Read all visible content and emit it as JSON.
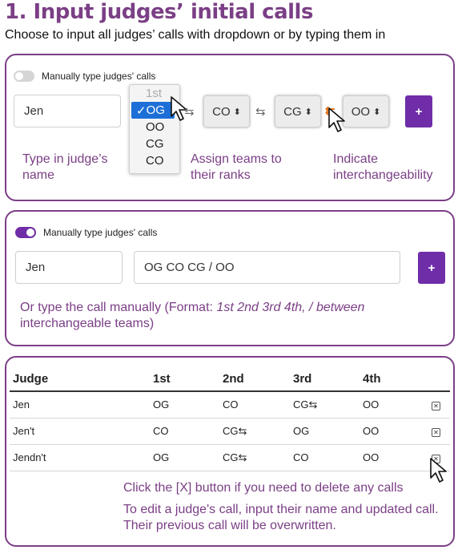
{
  "header": {
    "title": "1. Input judges’ initial calls",
    "subtitle": "Choose to input all judges’ calls with dropdown or by typing them in"
  },
  "panel_dropdown": {
    "toggle_label": "Manually type judges' calls",
    "toggle_on": false,
    "name_value": "Jen",
    "dropdown_options": [
      "1st",
      "OG",
      "OO",
      "CG",
      "CO"
    ],
    "selected_option": "OG",
    "check_mark": "✓",
    "rank_boxes": [
      "CO",
      "CG",
      "OO"
    ],
    "updown_glyph": "⬍",
    "swap_glyph": "⇆",
    "orange_arrow": "⇇",
    "add_label": "+",
    "hint_name": "Type in judge’s name",
    "hint_assign": "Assign teams to their ranks",
    "hint_interchange": "Indicate interchangeability",
    "colors": {
      "accent": "#6f2da8",
      "heading": "#7b3f86",
      "selection": "#1d6fd8",
      "interchange": "#e8731a"
    }
  },
  "panel_manual": {
    "toggle_label": "Manually type judges' calls",
    "toggle_on": true,
    "name_value": "Jen",
    "call_value": "OG CO CG / OO",
    "add_label": "+",
    "hint_prefix": "Or type the call manually (Format: ",
    "hint_format": "1st 2nd 3rd 4th, / between",
    "hint_suffix": " interchangeable teams)"
  },
  "calls_table": {
    "headers": [
      "Judge",
      "1st",
      "2nd",
      "3rd",
      "4th",
      ""
    ],
    "rows": [
      {
        "judge": "Jen",
        "first": "OG",
        "second": "CO",
        "third": "CG⇆",
        "fourth": "OO",
        "delete": "✕"
      },
      {
        "judge": "Jen't",
        "first": "CO",
        "second": "CG⇆",
        "third": "OG",
        "fourth": "OO",
        "delete": "✕"
      },
      {
        "judge": "Jendn't",
        "first": "OG",
        "second": "CG⇆",
        "third": "CO",
        "fourth": "OO",
        "delete": "✕"
      }
    ],
    "hint_delete": "Click the [X] button if you need to delete any calls",
    "hint_edit": "To edit a judge's call, input their name and updated call. Their previous call will be overwritten."
  }
}
